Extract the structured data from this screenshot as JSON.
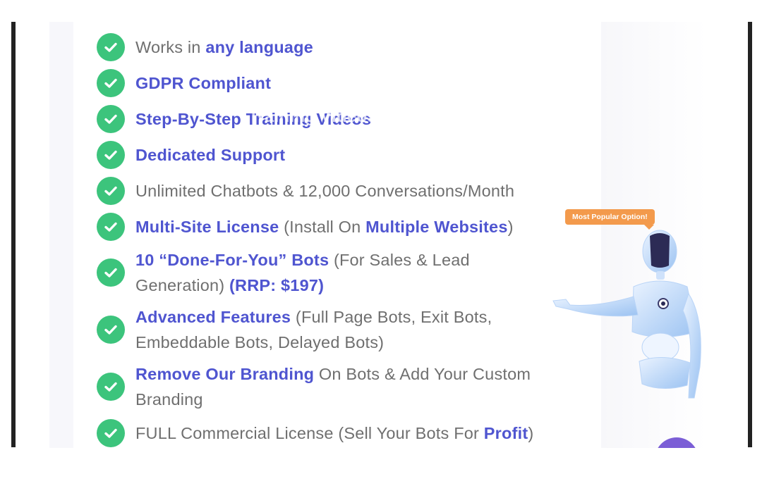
{
  "badge": {
    "label": "Most Popular Option!"
  },
  "watermark": "Training Videos",
  "features": [
    {
      "parts": [
        {
          "t": "Works in ",
          "b": false
        },
        {
          "t": "any language",
          "b": true
        }
      ]
    },
    {
      "parts": [
        {
          "t": "GDPR Compliant",
          "b": true
        }
      ]
    },
    {
      "parts": [
        {
          "t": "Step-By-Step Training Videos",
          "b": true
        }
      ]
    },
    {
      "parts": [
        {
          "t": "Dedicated Support",
          "b": true
        }
      ]
    },
    {
      "parts": [
        {
          "t": "Unlimited Chatbots & 12,000 Conversations/Month",
          "b": false
        }
      ]
    },
    {
      "parts": [
        {
          "t": "Multi-Site License",
          "b": true
        },
        {
          "t": " (Install On ",
          "b": false
        },
        {
          "t": "Multiple Websites",
          "b": true
        },
        {
          "t": ")",
          "b": false
        }
      ]
    },
    {
      "parts": [
        {
          "t": "10 “Done-For-You” Bots",
          "b": true
        },
        {
          "t": " (For Sales & Lead",
          "b": false
        },
        {
          "br": true
        },
        {
          "t": "Generation) ",
          "b": false
        },
        {
          "t": "(RRP: $197)",
          "b": true
        }
      ]
    },
    {
      "parts": [
        {
          "t": "Advanced Features",
          "b": true
        },
        {
          "t": " (Full Page Bots, Exit Bots,",
          "b": false
        },
        {
          "br": true
        },
        {
          "t": "Embeddable Bots, Delayed Bots)",
          "b": false
        }
      ]
    },
    {
      "parts": [
        {
          "t": "Remove Our Branding",
          "b": true
        },
        {
          "t": " On Bots & Add Your Custom",
          "b": false
        },
        {
          "br": true
        },
        {
          "t": "Branding",
          "b": false
        }
      ]
    },
    {
      "parts": [
        {
          "t": "FULL Commercial License (Sell Your Bots For ",
          "b": false
        },
        {
          "t": "Profit",
          "b": true
        },
        {
          "t": ")",
          "b": false
        }
      ]
    }
  ],
  "icons": {
    "check": "check-circle-icon",
    "robot": "robot-mascot-icon",
    "chat": "chat-widget-icon"
  },
  "colors": {
    "accent": "#4f55d0",
    "check": "#3cc47c",
    "badge": "#f39a4c",
    "chat": "#7b5ed6"
  }
}
